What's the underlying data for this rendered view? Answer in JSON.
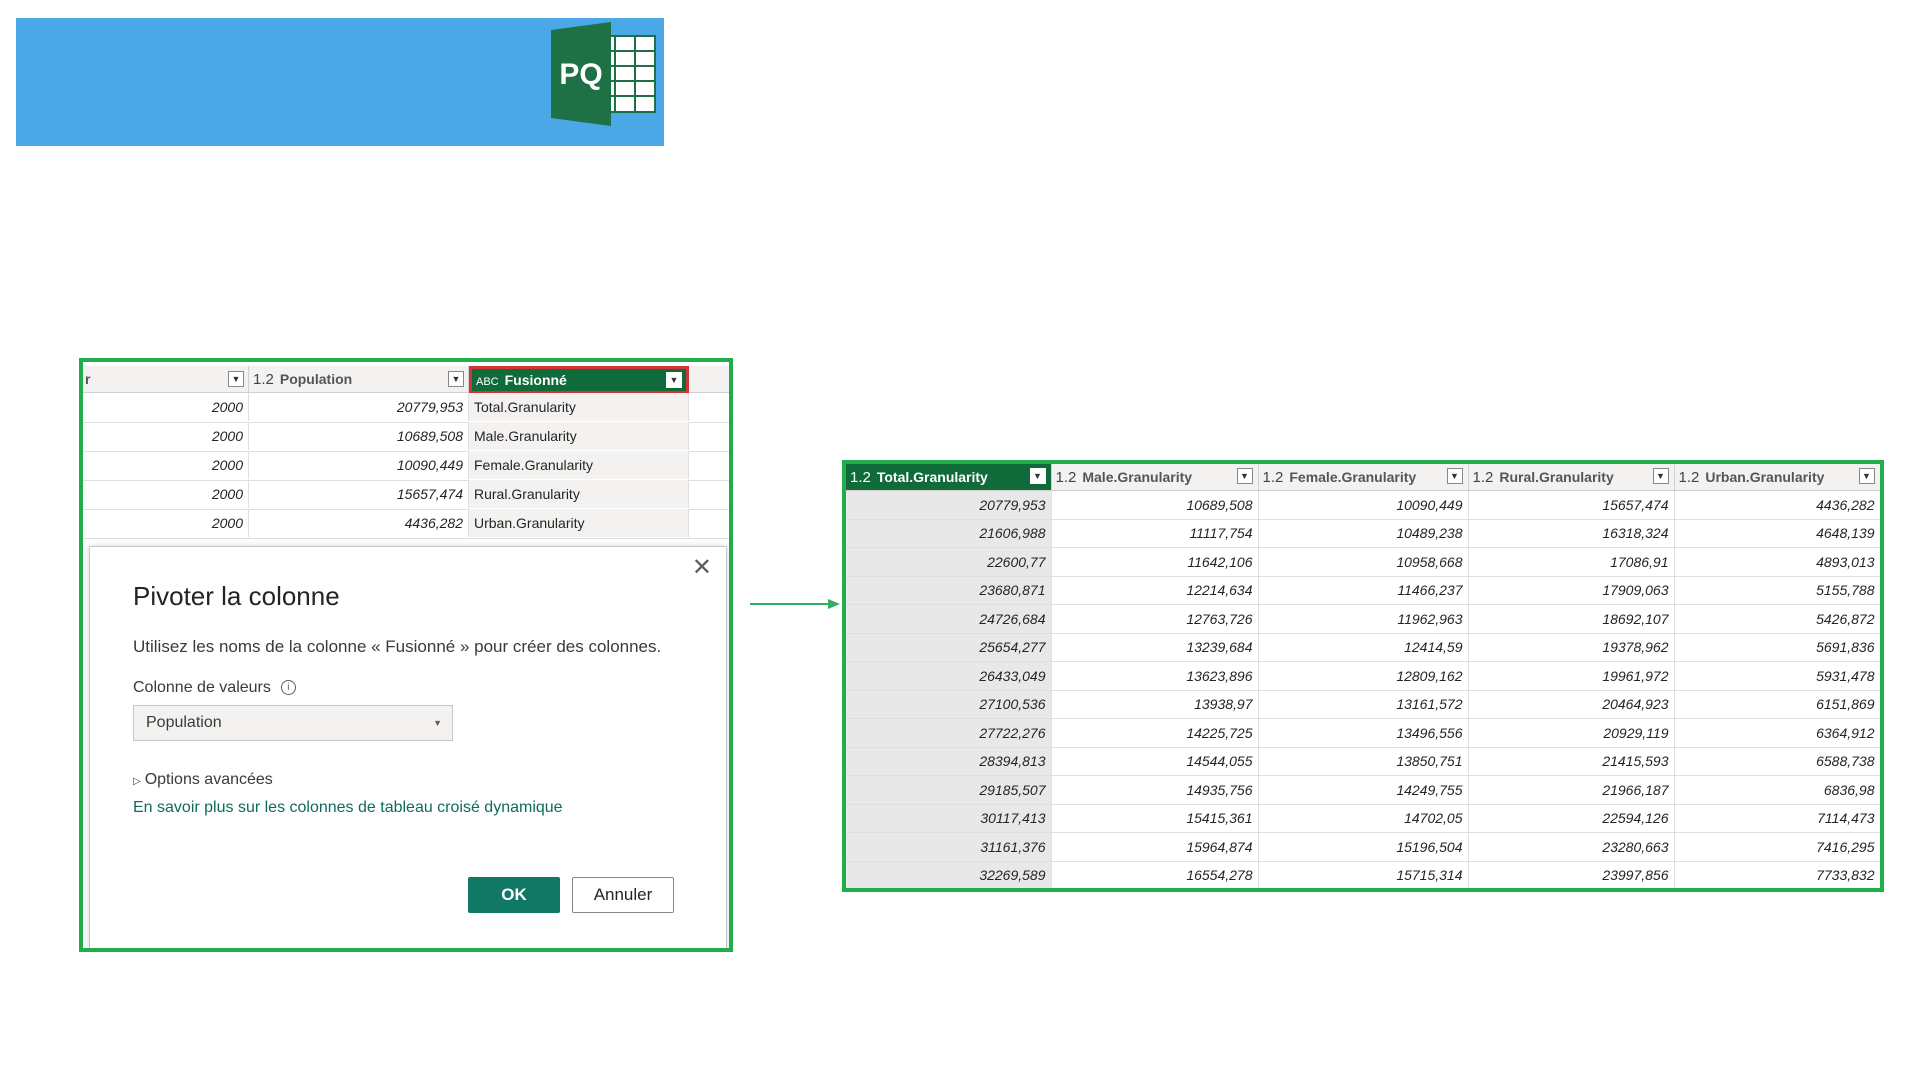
{
  "logo": {
    "text": "PQ",
    "icon": "power-query-excel-logo"
  },
  "left_grid": {
    "header": {
      "col1_partial": "r",
      "col2_type": "1.2",
      "col2_label": "Population",
      "col3_type": "ABC",
      "col3_label": "Fusionné"
    },
    "rows": [
      {
        "year": "2000",
        "population": "20779,953",
        "merged": "Total.Granularity"
      },
      {
        "year": "2000",
        "population": "10689,508",
        "merged": "Male.Granularity"
      },
      {
        "year": "2000",
        "population": "10090,449",
        "merged": "Female.Granularity"
      },
      {
        "year": "2000",
        "population": "15657,474",
        "merged": "Rural.Granularity"
      },
      {
        "year": "2000",
        "population": "4436,282",
        "merged": "Urban.Granularity"
      }
    ]
  },
  "dialog": {
    "title": "Pivoter la colonne",
    "description": "Utilisez les noms de la colonne « Fusionné » pour créer des colonnes.",
    "values_label": "Colonne de valeurs",
    "values_selected": "Population",
    "advanced": "Options avancées",
    "learn_more": "En savoir plus sur les colonnes de tableau croisé dynamique",
    "ok": "OK",
    "cancel": "Annuler",
    "close": "✕"
  },
  "right_table": {
    "type_label": "1.2",
    "columns": [
      "Total.Granularity",
      "Male.Granularity",
      "Female.Granularity",
      "Rural.Granularity",
      "Urban.Granularity"
    ],
    "rows": [
      [
        "20779,953",
        "10689,508",
        "10090,449",
        "15657,474",
        "4436,282"
      ],
      [
        "21606,988",
        "11117,754",
        "10489,238",
        "16318,324",
        "4648,139"
      ],
      [
        "22600,77",
        "11642,106",
        "10958,668",
        "17086,91",
        "4893,013"
      ],
      [
        "23680,871",
        "12214,634",
        "11466,237",
        "17909,063",
        "5155,788"
      ],
      [
        "24726,684",
        "12763,726",
        "11962,963",
        "18692,107",
        "5426,872"
      ],
      [
        "25654,277",
        "13239,684",
        "12414,59",
        "19378,962",
        "5691,836"
      ],
      [
        "26433,049",
        "13623,896",
        "12809,162",
        "19961,972",
        "5931,478"
      ],
      [
        "27100,536",
        "13938,97",
        "13161,572",
        "20464,923",
        "6151,869"
      ],
      [
        "27722,276",
        "14225,725",
        "13496,556",
        "20929,119",
        "6364,912"
      ],
      [
        "28394,813",
        "14544,055",
        "13850,751",
        "21415,593",
        "6588,738"
      ],
      [
        "29185,507",
        "14935,756",
        "14249,755",
        "21966,187",
        "6836,98"
      ],
      [
        "30117,413",
        "15415,361",
        "14702,05",
        "22594,126",
        "7114,473"
      ],
      [
        "31161,376",
        "15964,874",
        "15196,504",
        "23280,663",
        "7416,295"
      ],
      [
        "32269,589",
        "16554,278",
        "15715,314",
        "23997,856",
        "7733,832"
      ]
    ]
  },
  "colors": {
    "banner": "#4aa8e6",
    "highlight_border": "#22ad4c",
    "active_header": "#0f6b3a",
    "selected_outline": "#d13438",
    "ok_button": "#117865"
  }
}
